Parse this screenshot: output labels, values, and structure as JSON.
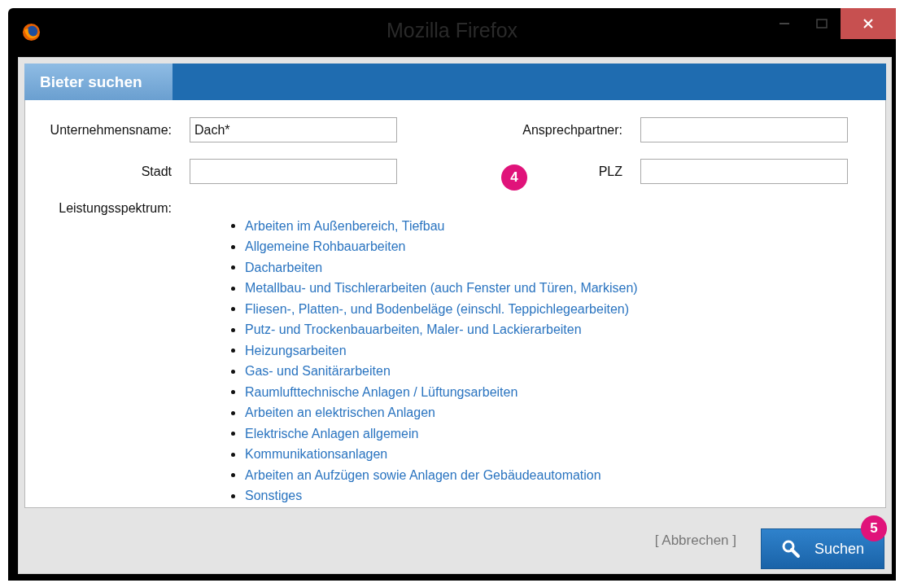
{
  "window": {
    "title": "Mozilla Firefox"
  },
  "tab": {
    "label": "Bieter suchen",
    "selected": true
  },
  "form": {
    "left": [
      {
        "label": "Unternehmensname:",
        "value": "Dach*"
      },
      {
        "label": "Stadt"
      }
    ],
    "right": [
      {
        "label": "Ansprechpartner:"
      },
      {
        "label": "PLZ"
      }
    ]
  },
  "annotations": [
    {
      "label": "4"
    },
    {
      "label": "5"
    }
  ],
  "services": {
    "label": "Leistungsspektrum:",
    "items": [
      "Arbeiten im Außenbereich, Tiefbau",
      "Allgemeine Rohbauarbeiten",
      "Dacharbeiten",
      "Metallbau- und Tischlerarbeiten (auch Fenster und Türen, Markisen)",
      "Fliesen-, Platten-, und Bodenbeläge (einschl. Teppichlegearbeiten)",
      "Putz- und Trockenbauarbeiten, Maler- und Lackierarbeiten",
      "Heizungsarbeiten",
      "Gas- und Sanitärarbeiten",
      "Raumlufttechnische Anlagen / Lüftungsarbeiten",
      "Arbeiten an elektrischen Anlagen",
      "Elektrische Anlagen allgemein",
      "Kommunikationsanlagen",
      "Arbeiten an Aufzügen sowie Anlagen der Gebäudeautomation",
      "Sonstiges"
    ]
  },
  "buttons": {
    "cancel": "[ Abbrechen ]",
    "search": "Suchen"
  }
}
